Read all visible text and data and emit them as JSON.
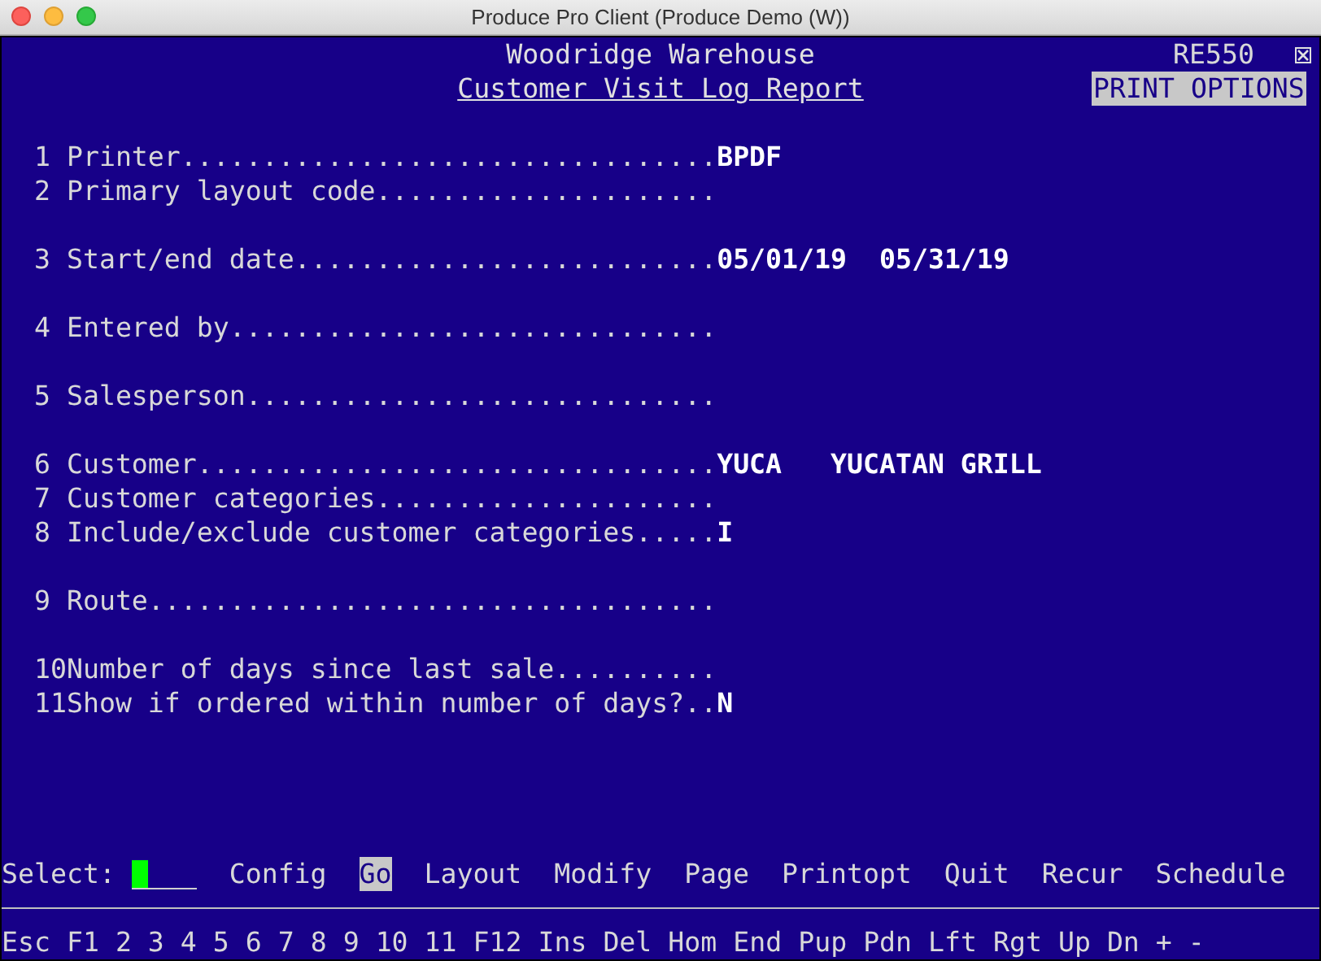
{
  "window": {
    "title": "Produce Pro Client (Produce Demo (W))"
  },
  "header": {
    "company": "Woodridge Warehouse",
    "program": "RE550",
    "report_title": "Customer Visit Log Report",
    "mode": "PRINT OPTIONS"
  },
  "field_groups": [
    {
      "fields": [
        {
          "number": "1",
          "label": "Printer.................................",
          "value": "BPDF"
        },
        {
          "number": "2",
          "label": "Primary layout code....................."
        }
      ]
    },
    {
      "fields": [
        {
          "number": "3",
          "label": "Start/end date..........................",
          "value": "05/01/19  05/31/19"
        }
      ]
    },
    {
      "fields": [
        {
          "number": "4",
          "label": "Entered by.............................."
        }
      ]
    },
    {
      "fields": [
        {
          "number": "5",
          "label": "Salesperson............................."
        }
      ]
    },
    {
      "fields": [
        {
          "number": "6",
          "label": "Customer................................",
          "value": "YUCA   YUCATAN GRILL"
        },
        {
          "number": "7",
          "label": "Customer categories....................."
        },
        {
          "number": "8",
          "label": "Include/exclude customer categories.....",
          "value": "I"
        }
      ]
    },
    {
      "fields": [
        {
          "number": "9",
          "label": "Route..................................."
        }
      ]
    },
    {
      "fields": [
        {
          "number": "10",
          "label": "Number of days since last sale.........."
        },
        {
          "number": "11",
          "label": "Show if ordered within number of days?..",
          "value": "N"
        }
      ]
    }
  ],
  "select": {
    "label": "Select:",
    "options": [
      {
        "label": "Config",
        "selected": false
      },
      {
        "label": "Go",
        "selected": true
      },
      {
        "label": "Layout",
        "selected": false
      },
      {
        "label": "Modify",
        "selected": false
      },
      {
        "label": "Page",
        "selected": false
      },
      {
        "label": "Printopt",
        "selected": false
      },
      {
        "label": "Quit",
        "selected": false
      },
      {
        "label": "Recur",
        "selected": false
      },
      {
        "label": "Schedule",
        "selected": false
      }
    ]
  },
  "function_keys": [
    "Esc",
    "F1",
    "2",
    "3",
    "4",
    "5",
    "6",
    "7",
    "8",
    "9",
    "10",
    "11",
    "F12",
    "Ins",
    "Del",
    "Hom",
    "End",
    "Pup",
    "Pdn",
    "Lft",
    "Rgt",
    "Up",
    "Dn",
    "+",
    "-"
  ]
}
